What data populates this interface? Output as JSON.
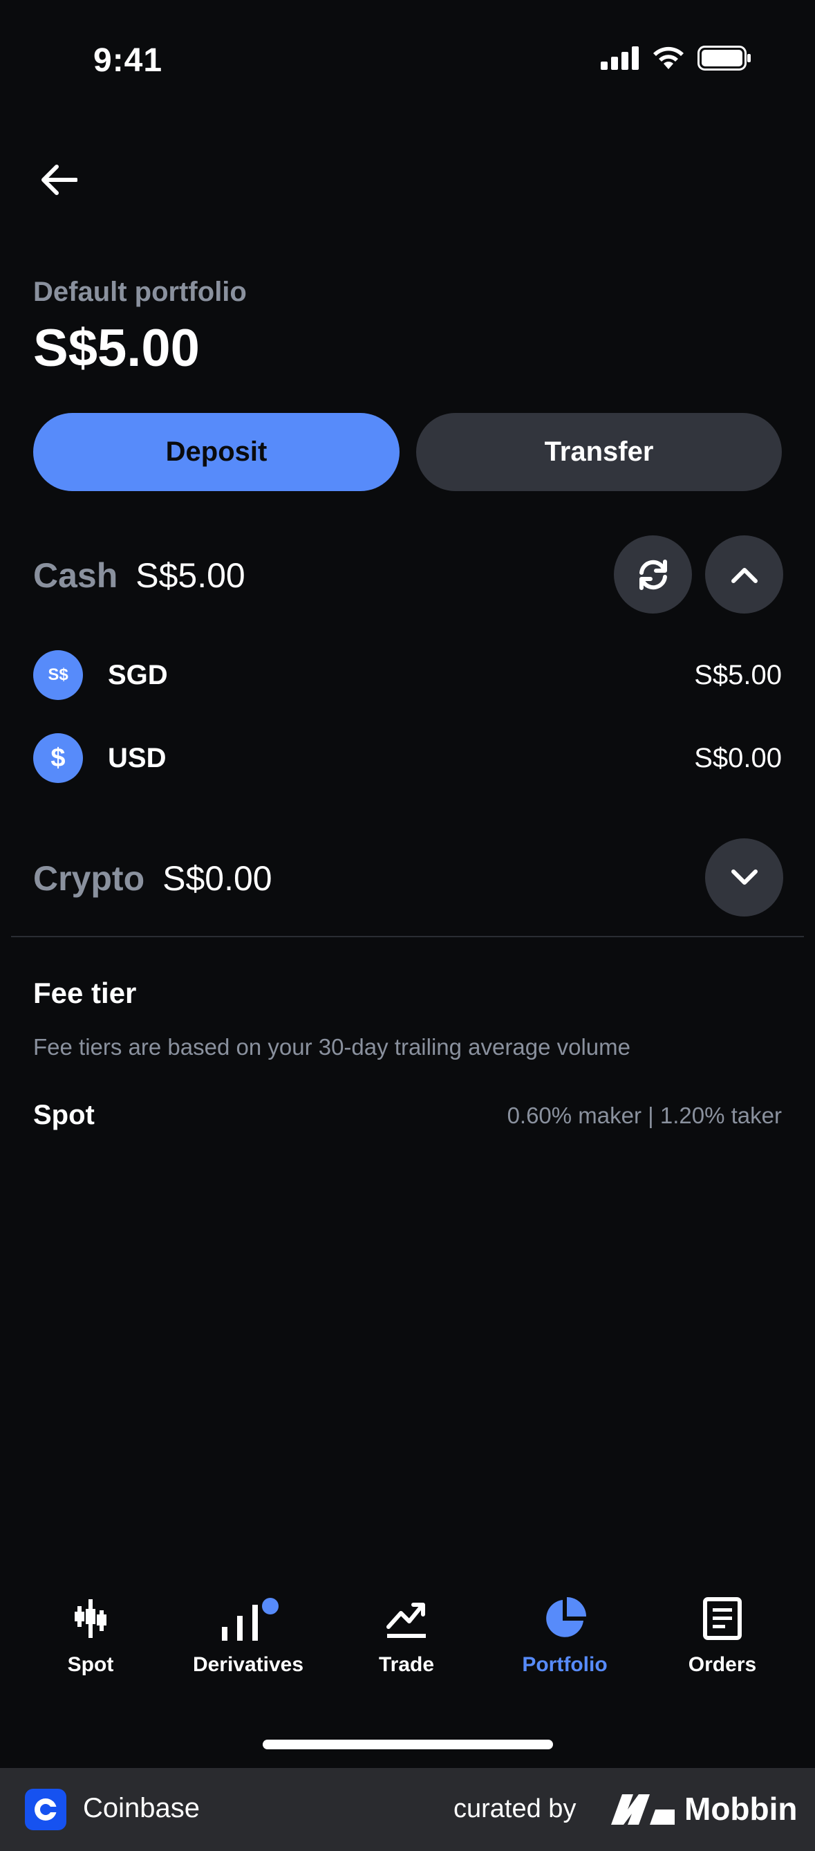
{
  "status_bar": {
    "time": "9:41"
  },
  "portfolio": {
    "label": "Default portfolio",
    "value": "S$5.00"
  },
  "actions": {
    "deposit": "Deposit",
    "transfer": "Transfer"
  },
  "cash": {
    "title": "Cash",
    "amount": "S$5.00",
    "assets": [
      {
        "icon_text": "S$",
        "name": "SGD",
        "value": "S$5.00"
      },
      {
        "icon_text": "$",
        "name": "USD",
        "value": "S$0.00"
      }
    ]
  },
  "crypto": {
    "title": "Crypto",
    "amount": "S$0.00"
  },
  "fee_tier": {
    "title": "Fee tier",
    "description": "Fee tiers are based on your 30-day trailing average volume",
    "spot_label": "Spot",
    "spot_value": "0.60% maker | 1.20% taker"
  },
  "tabs": [
    {
      "label": "Spot",
      "icon": "candlestick-icon"
    },
    {
      "label": "Derivatives",
      "icon": "bar-chart-icon"
    },
    {
      "label": "Trade",
      "icon": "trend-icon"
    },
    {
      "label": "Portfolio",
      "icon": "pie-chart-icon",
      "active": true
    },
    {
      "label": "Orders",
      "icon": "document-icon"
    }
  ],
  "footer": {
    "brand": "Coinbase",
    "curated_by": "curated by",
    "mobbin": "Mobbin"
  },
  "colors": {
    "accent": "#578bfa",
    "background": "#0a0b0d",
    "surface": "#32353d",
    "muted": "#8a919e"
  }
}
